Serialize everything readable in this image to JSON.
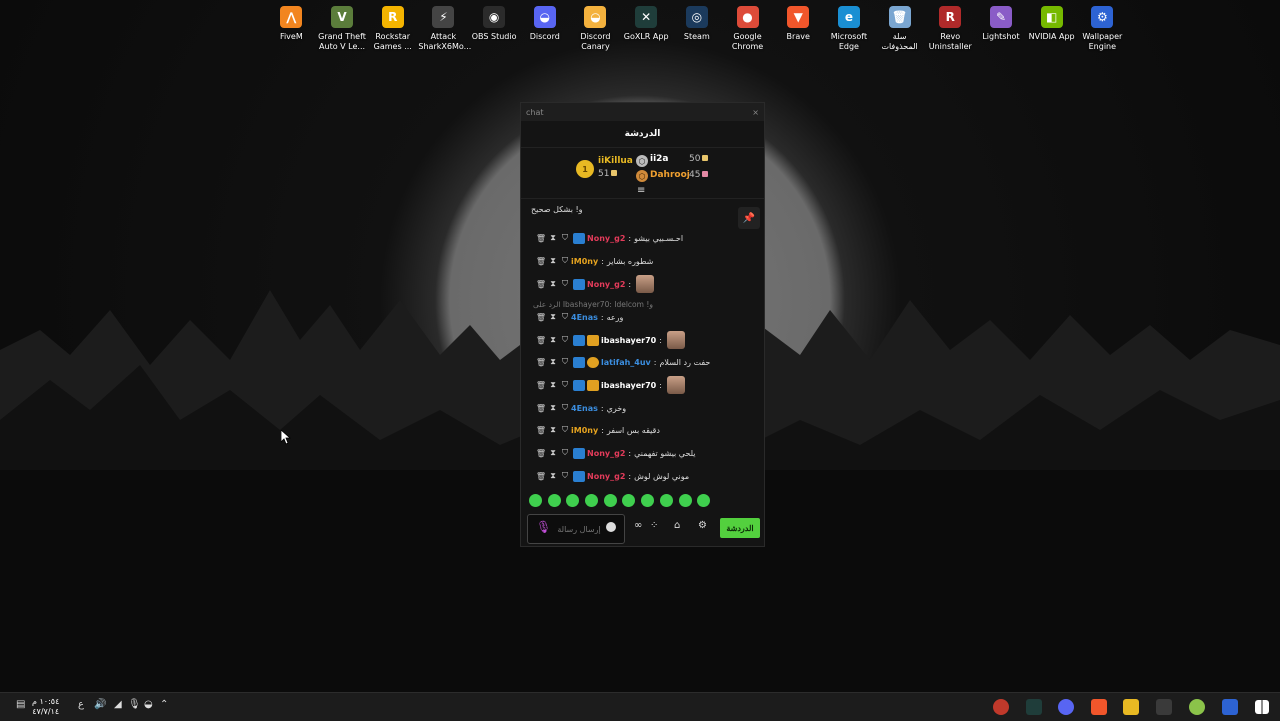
{
  "desktop": {
    "icons": [
      {
        "label": "FiveM",
        "color": "#f2851f",
        "glyph": "⋀"
      },
      {
        "label": "Grand Theft Auto V Le...",
        "color": "#5b7d3b",
        "glyph": "V"
      },
      {
        "label": "Rockstar Games ...",
        "color": "#f4b400",
        "glyph": "R"
      },
      {
        "label": "Attack SharkX6Mo...",
        "color": "#444444",
        "glyph": "⚡"
      },
      {
        "label": "OBS Studio",
        "color": "#2b2b2b",
        "glyph": "◉"
      },
      {
        "label": "Discord",
        "color": "#5865f2",
        "glyph": "◒"
      },
      {
        "label": "Discord Canary",
        "color": "#f4b23e",
        "glyph": "◒"
      },
      {
        "label": "GoXLR App",
        "color": "#1f3d3a",
        "glyph": "✕"
      },
      {
        "label": "Steam",
        "color": "#1b3a5c",
        "glyph": "◎"
      },
      {
        "label": "Google Chrome",
        "color": "#dd4b39",
        "glyph": "●"
      },
      {
        "label": "Brave",
        "color": "#f1562b",
        "glyph": "▼"
      },
      {
        "label": "Microsoft Edge",
        "color": "#1a8fd3",
        "glyph": "e"
      },
      {
        "label": "سلة المحذوفات",
        "color": "#7aa6d1",
        "glyph": "🗑"
      },
      {
        "label": "Revo Uninstaller",
        "color": "#b02a2a",
        "glyph": "R"
      },
      {
        "label": "Lightshot",
        "color": "#8a5cc7",
        "glyph": "✎"
      },
      {
        "label": "NVIDIA App",
        "color": "#76b900",
        "glyph": "◧"
      },
      {
        "label": "Wallpaper Engine",
        "color": "#2d63d3",
        "glyph": "⚙"
      }
    ]
  },
  "chat": {
    "window_title": "chat",
    "close": "×",
    "header": "الدردشة",
    "leaderboard": {
      "first": {
        "rank": "1",
        "name": "iiKillua",
        "points": "51"
      },
      "second": {
        "name": "ii2a",
        "points": "50"
      },
      "third": {
        "name": "Dahrooj",
        "points": "45"
      }
    },
    "partial_message": "و! بشكل صحيح",
    "reply_line": "الرد على Ibashayer70: Idelcom !و",
    "messages": [
      {
        "user": "Nony_g2",
        "user_color": "#e23b5a",
        "text": "احـسـبيي بيشو",
        "badges": "pf"
      },
      {
        "user": "iM0ny",
        "user_color": "#e6a31f",
        "text": "شطوره بشاير",
        "badges": ""
      },
      {
        "user": "Nony_g2",
        "user_color": "#e23b5a",
        "text": "",
        "badges": "pf",
        "avatar": true
      },
      {
        "user": "4Enas",
        "user_color": "#3b8ee0",
        "text": "ورعه",
        "badges": ""
      },
      {
        "user": "ibashayer70",
        "user_color": "#ffffff",
        "text": "",
        "badges": "pfcrown",
        "avatar": true
      },
      {
        "user": "latifah_4uv",
        "user_color": "#3b8ee0",
        "text": "حفت رد السلام",
        "badges": "pfgold"
      },
      {
        "user": "ibashayer70",
        "user_color": "#ffffff",
        "text": "",
        "badges": "pfcrown",
        "avatar": true
      },
      {
        "user": "4Enas",
        "user_color": "#3b8ee0",
        "text": "وخري",
        "badges": ""
      },
      {
        "user": "iM0ny",
        "user_color": "#e6a31f",
        "text": "دقيقه بس اسفر",
        "badges": ""
      },
      {
        "user": "Nony_g2",
        "user_color": "#e23b5a",
        "text": "يلحي بيشو تفهمني",
        "badges": "pf"
      },
      {
        "user": "Nony_g2",
        "user_color": "#e23b5a",
        "text": "موني لوش لوش",
        "badges": "pf"
      }
    ],
    "composer_placeholder": "إرسال رسالة",
    "send_label": "الدردشة"
  },
  "taskbar": {
    "time": "١٠:٥٤ م",
    "date": "٤٧/٧/١٤",
    "lang": "ع"
  }
}
